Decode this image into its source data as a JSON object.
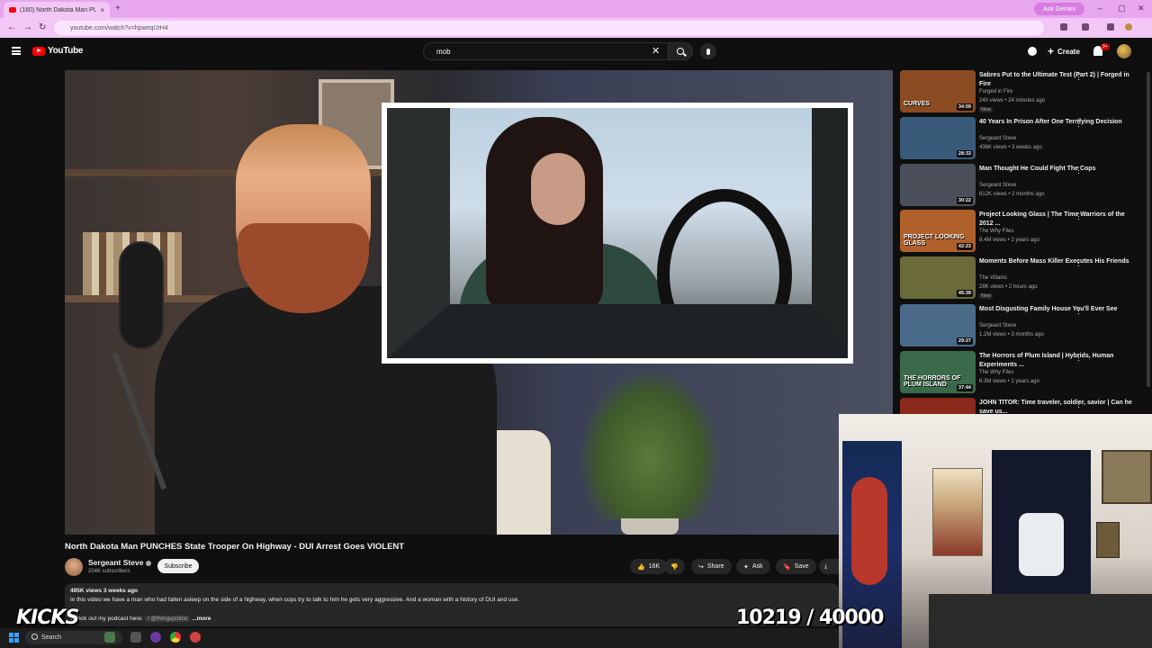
{
  "browser": {
    "tab_title": "(160) North Dakota Man PU...",
    "tab_close": "×",
    "new_tab": "+",
    "ask_gemini": "Ask Gemini",
    "url": "youtube.com/watch?v=hpwnqUrH4",
    "win_min": "–",
    "win_max": "▢",
    "win_close": "✕"
  },
  "header": {
    "logo_text": "YouTube",
    "search_value": "mob",
    "clear": "✕",
    "create_label": "Create",
    "notifications": "9+"
  },
  "video": {
    "title": "North Dakota Man PUNCHES State Trooper On Highway - DUI Arrest Goes VIOLENT",
    "channel": "Sergeant Steve",
    "subscribers": "204K subscribers",
    "subscribe_label": "Subscribe",
    "likes": "16K",
    "share_label": "Share",
    "ask_label": "Ask",
    "save_label": "Save",
    "views_line": "495K views  3 weeks ago",
    "description": "In this video we have a man who had fallen asleep on the side of a highway, when cops try to talk to him he gets very aggressive. And a woman with a history of DUI and use.",
    "podcast_prefix": "Check out my podcast here: ",
    "podcast_link": "/ @thingspolice",
    "more_label": "...more"
  },
  "overlay": {
    "kicks": "KICKS",
    "counter": "10219 / 40000"
  },
  "recommendations": [
    {
      "title": "Sabres Put to the Ultimate Test (Part 2) | Forged in Fire",
      "channel": "Forged in Fire",
      "meta": "240 views • 24 minutes ago",
      "badge": "New",
      "duration": "34:59",
      "thumb_text": "CURVES",
      "color": "#8a4a22"
    },
    {
      "title": "40 Years In Prison After One Terrifying Decision",
      "channel": "Sergeant Steve",
      "meta": "436K views • 3 weeks ago",
      "badge": "",
      "duration": "28:33",
      "thumb_text": "",
      "color": "#3a5a7a"
    },
    {
      "title": "Man Thought He Could Fight The Cops",
      "channel": "Sergeant Steve",
      "meta": "612K views • 2 months ago",
      "badge": "",
      "duration": "30:22",
      "thumb_text": "",
      "color": "#4a4f5a"
    },
    {
      "title": "Project Looking Glass | The Time Warriors of the 2012 ...",
      "channel": "The Why Files",
      "meta": "8.4M views • 2 years ago",
      "badge": "",
      "duration": "42:23",
      "thumb_text": "PROJECT LOOKING GLASS",
      "color": "#b0602a"
    },
    {
      "title": "Moments Before Mass Killer Executes His Friends",
      "channel": "The Villains",
      "meta": "28K views • 2 hours ago",
      "badge": "New",
      "duration": "45:39",
      "thumb_text": "",
      "color": "#6a6a3a"
    },
    {
      "title": "Most Disgusting Family House You'll Ever See",
      "channel": "Sergeant Steve",
      "meta": "1.2M views • 3 months ago",
      "badge": "",
      "duration": "29:27",
      "thumb_text": "",
      "color": "#4a6a8a"
    },
    {
      "title": "The Horrors of Plum Island | Hybrids, Human Experiments ...",
      "channel": "The Why Files",
      "meta": "6.3M views • 2 years ago",
      "badge": "",
      "duration": "37:44",
      "thumb_text": "THE HORRORS OF PLUM ISLAND",
      "color": "#3a6a4a"
    },
    {
      "title": "JOHN TITOR: Time traveler, soldier, savior | Can he save us...",
      "channel": "",
      "meta": "",
      "badge": "",
      "duration": "",
      "thumb_text": "",
      "color": "#8a2a1a"
    }
  ],
  "taskbar": {
    "search_label": "Search"
  }
}
